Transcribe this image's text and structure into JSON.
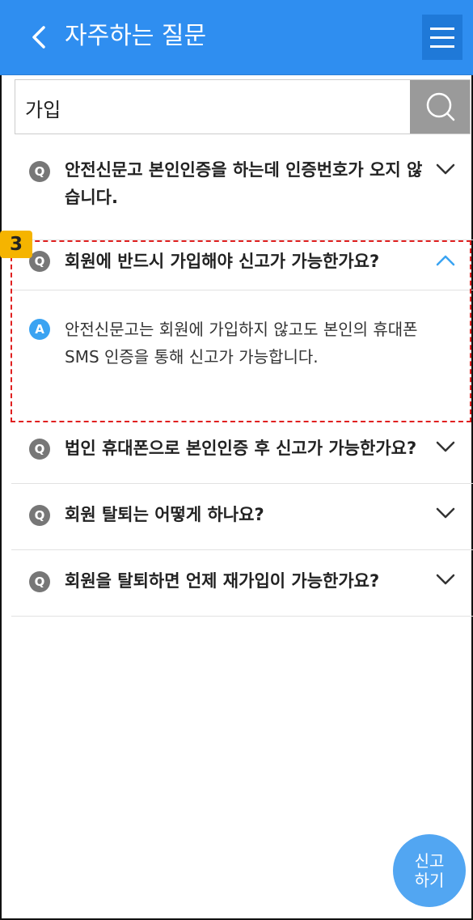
{
  "header": {
    "title": "자주하는 질문",
    "back_icon": "chevron-left-icon",
    "menu_icon": "hamburger-menu-icon"
  },
  "search": {
    "value": "가입",
    "placeholder": "",
    "button_icon": "search-icon"
  },
  "faq": {
    "items": [
      {
        "q_badge": "Q",
        "question": "안전신문고 본인인증을 하는데 인증번호가 오지 않습니다.",
        "expanded": false
      },
      {
        "q_badge": "Q",
        "question": "회원에 반드시 가입해야 신고가 가능한가요?",
        "expanded": true,
        "a_badge": "A",
        "answer": "안전신문고는 회원에 가입하지 않고도 본인의 휴대폰 SMS 인증을 통해 신고가 가능합니다."
      },
      {
        "q_badge": "Q",
        "question": "법인 휴대폰으로 본인인증 후 신고가 가능한가요?",
        "expanded": false
      },
      {
        "q_badge": "Q",
        "question": "회원 탈퇴는 어떻게 하나요?",
        "expanded": false
      },
      {
        "q_badge": "Q",
        "question": "회원을 탈퇴하면 언제 재가입이 가능한가요?",
        "expanded": false
      }
    ]
  },
  "annotation": {
    "step": "3"
  },
  "report_button": {
    "line1": "신고",
    "line2": "하기"
  },
  "colors": {
    "header": "#2f8ef0",
    "answer_badge": "#3aa3f2",
    "highlight": "#e02020",
    "step_badge": "#f5b400"
  }
}
